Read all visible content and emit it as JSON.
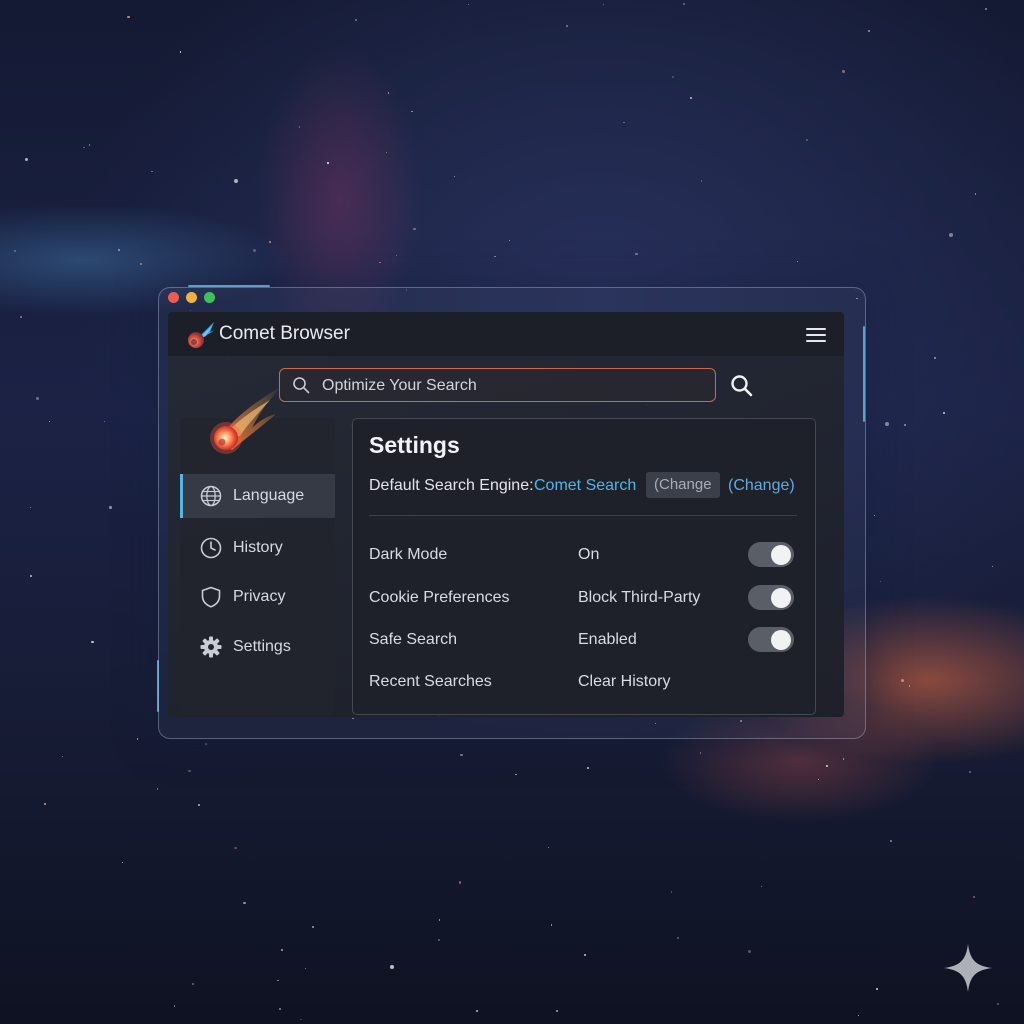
{
  "app": {
    "title": "Comet Browser"
  },
  "search": {
    "placeholder": "Optimize Your Search"
  },
  "sidebar": {
    "items": [
      {
        "label": "Language",
        "icon": "globe-icon",
        "active": true
      },
      {
        "label": "History",
        "icon": "clock-icon",
        "active": false
      },
      {
        "label": "Privacy",
        "icon": "shield-icon",
        "active": false
      },
      {
        "label": "Settings",
        "icon": "gear-icon",
        "active": false
      }
    ]
  },
  "settings": {
    "title": "Settings",
    "engine_label": "Default Search Engine:",
    "engine_value": "Comet Search",
    "change_chip": "(Change",
    "change_link": "(Change)",
    "rows": [
      {
        "label": "Dark Mode",
        "value": "On",
        "toggle": true
      },
      {
        "label": "Cookie Preferences",
        "value": "Block Third-Party",
        "toggle": true
      },
      {
        "label": "Safe Search",
        "value": "Enabled",
        "toggle": true
      },
      {
        "label": "Recent Searches",
        "value": "Clear History",
        "toggle": false
      }
    ]
  },
  "colors": {
    "accent": "#4fb6ea",
    "search_border": "#c66a54",
    "traffic_red": "#ee5b50",
    "traffic_yellow": "#f2b33a",
    "traffic_green": "#3fc15a"
  }
}
